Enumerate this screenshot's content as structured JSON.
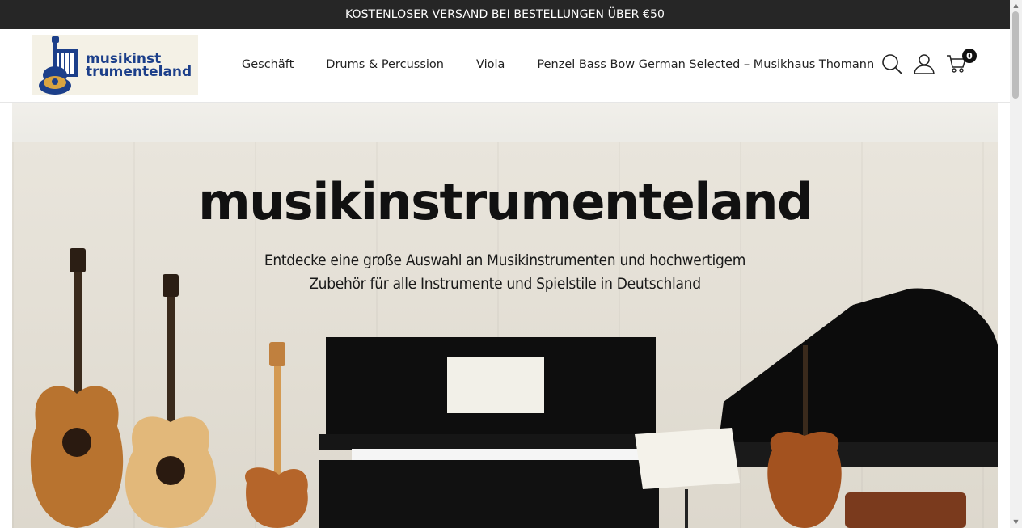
{
  "announcement": "KOSTENLOSER VERSAND BEI BESTELLUNGEN ÜBER €50",
  "logo": {
    "line1": "musikinst",
    "line2": "trumenteland",
    "colors": {
      "blue": "#1c3f8a",
      "gold": "#d9a441"
    }
  },
  "nav": [
    {
      "label": "Geschäft"
    },
    {
      "label": "Drums & Percussion"
    },
    {
      "label": "Viola"
    },
    {
      "label": "Penzel Bass Bow German Selected – Musikhaus Thomann"
    }
  ],
  "icons": {
    "search": "search-icon",
    "account": "user-icon",
    "cart": "cart-icon"
  },
  "cart": {
    "count": "0"
  },
  "hero": {
    "title": "musikinstrumenteland",
    "subtitle_line1": "Entdecke eine große Auswahl an Musikinstrumenten und hochwertigem",
    "subtitle_line2": "Zubehör für alle Instrumente und Spielstile in Deutschland"
  },
  "colors": {
    "topbar_bg": "#262626",
    "accent": "#111111"
  }
}
